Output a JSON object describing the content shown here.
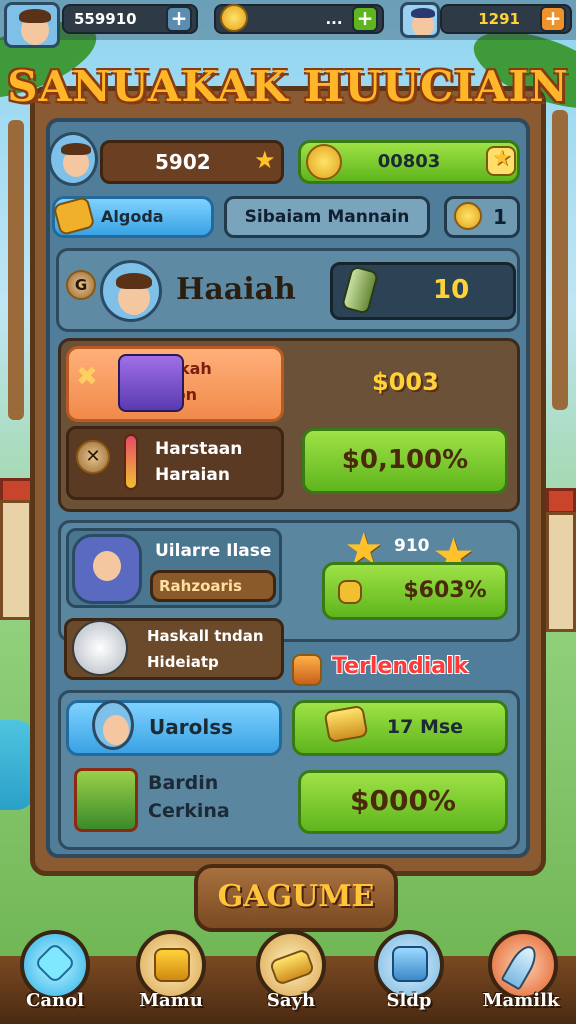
{
  "topbar": {
    "currency1": "559910",
    "currency2": "...",
    "currency3": "1291"
  },
  "title": "SANUAKAK HUUCIAIN",
  "stats": {
    "left_value": "5902",
    "right_value": "00803"
  },
  "row2": {
    "tag_label": "Algoda",
    "center_button": "Sibaiam Mannain",
    "coins": "1"
  },
  "player": {
    "badge": "G",
    "name": "Haaiah",
    "energy": "10"
  },
  "section1": {
    "item1_line1": "Hrarkah",
    "item1_line2": "Hanon",
    "price1": "$003",
    "item2_line1": "Harstaan",
    "item2_line2": "Haraian",
    "buy_button": "$0,100%"
  },
  "section2": {
    "item1_line1": "Uilarre Ilase",
    "item1_line2": "Rahzoaris",
    "reward_label": "910",
    "reward_button": "$603%",
    "item2_line1": "Haskall tndan",
    "item2_line2": "Hideiatp",
    "trending_label": "Terlendialk"
  },
  "section3": {
    "blue_button": "Uarolss",
    "green_label": "17 Mse",
    "item_line1": "Bardin",
    "item_line2": "Cerkina",
    "big_button": "$000%"
  },
  "play_button": "GAGUME",
  "nav": {
    "items": [
      {
        "label": "Canol",
        "icon": "gem-icon"
      },
      {
        "label": "Mamu",
        "icon": "chest-icon"
      },
      {
        "label": "Sayh",
        "icon": "gold-bar-icon"
      },
      {
        "label": "Sldp",
        "icon": "shop-icon"
      },
      {
        "label": "Mamilk",
        "icon": "feather-icon"
      }
    ]
  },
  "colors": {
    "accent_gold": "#ffb629",
    "button_green": "#7ed032",
    "panel_blue": "#4f7d9a",
    "wood": "#8a5a32"
  }
}
